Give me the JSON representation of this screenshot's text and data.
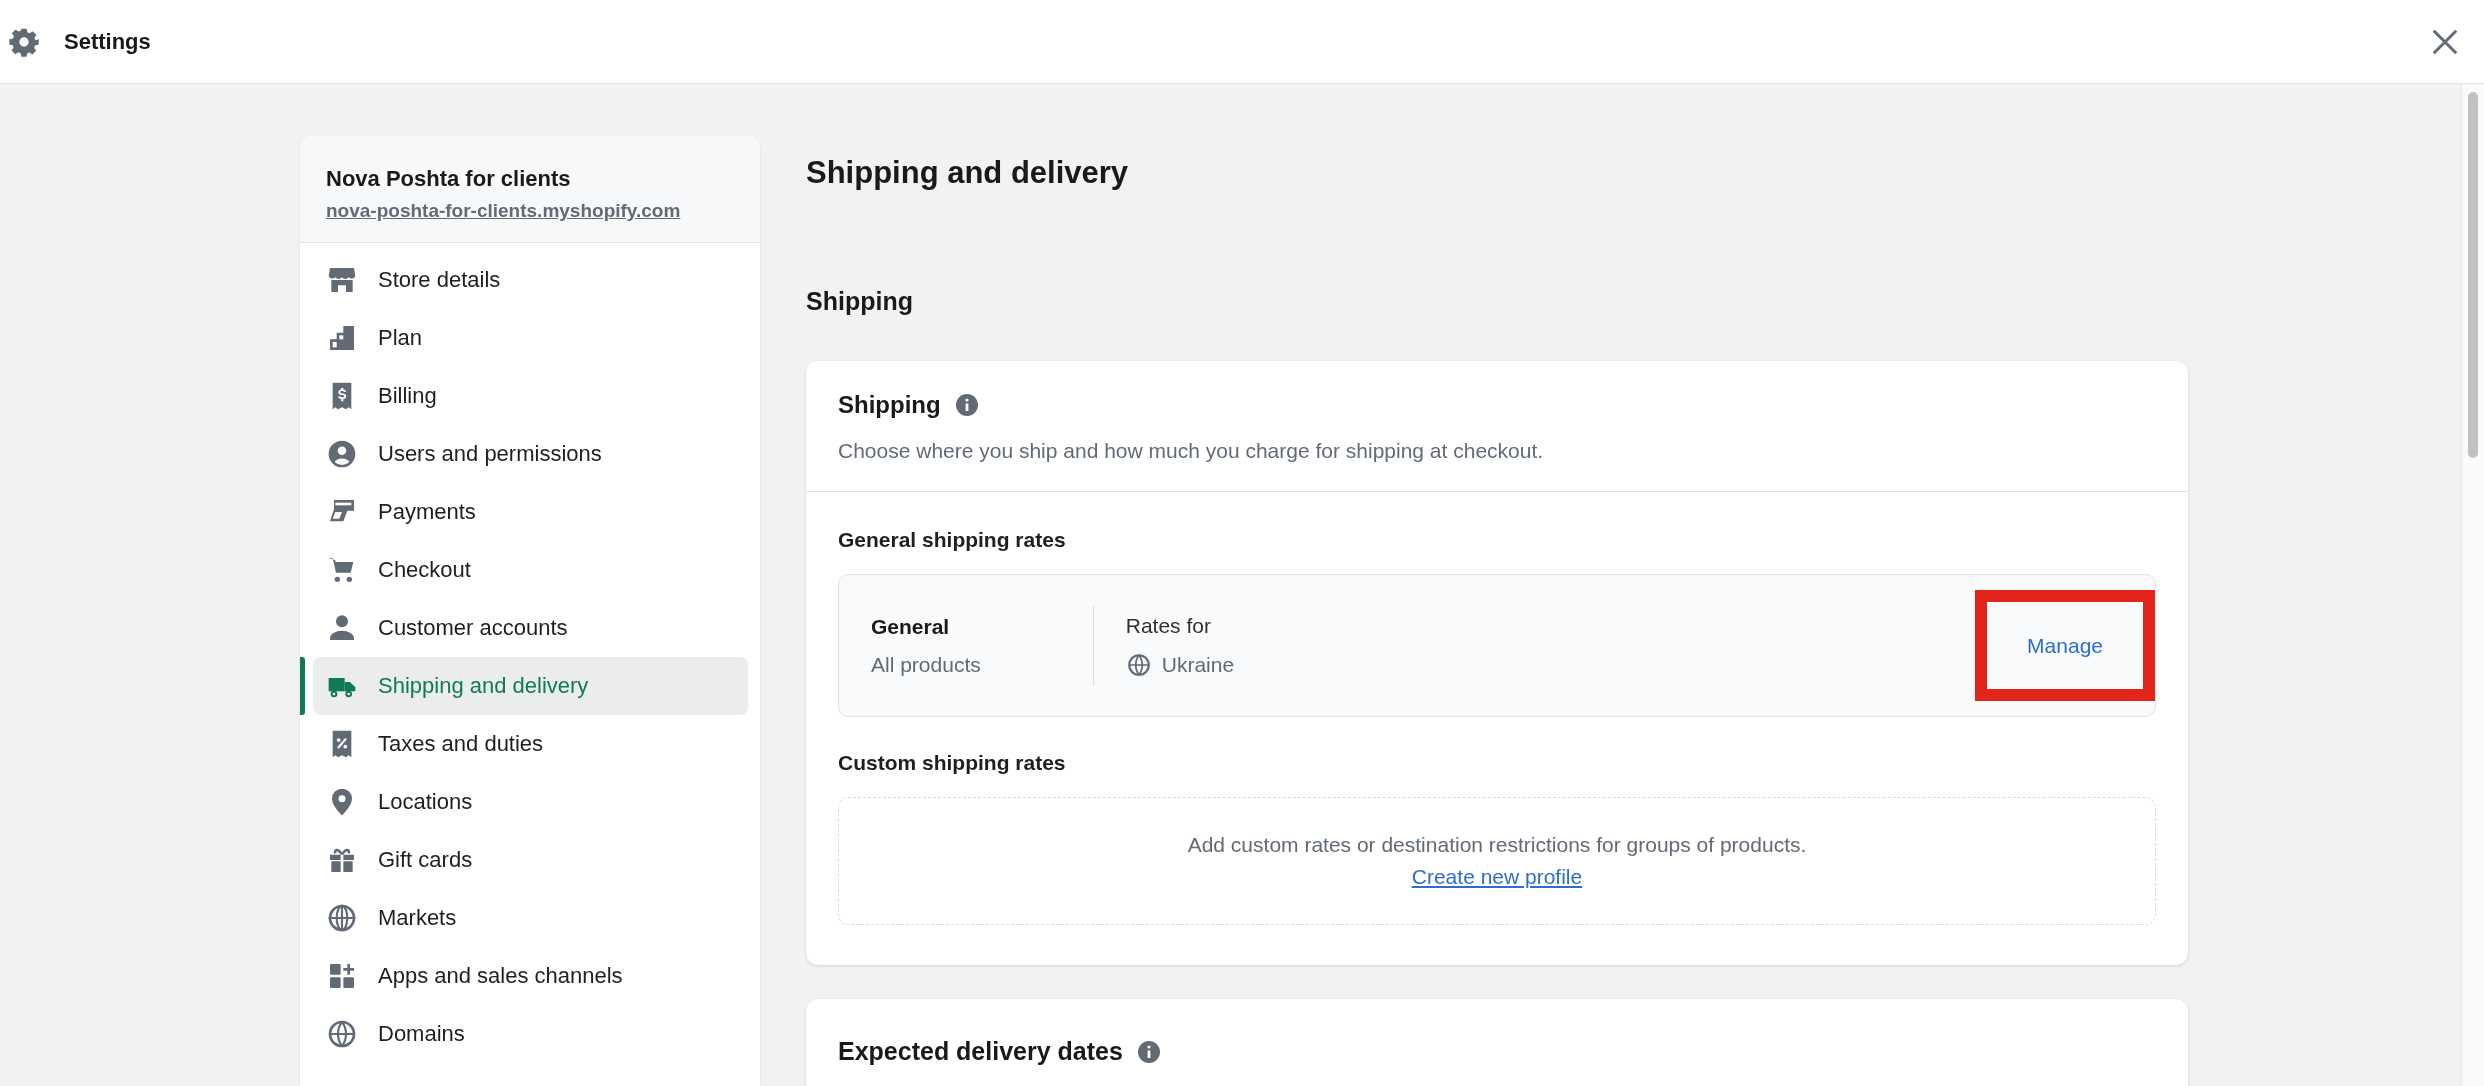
{
  "window": {
    "title": "Settings"
  },
  "store": {
    "name": "Nova Poshta for clients",
    "domain": "nova-poshta-for-clients.myshopify.com"
  },
  "nav": [
    {
      "label": "Store details",
      "selected": false
    },
    {
      "label": "Plan",
      "selected": false
    },
    {
      "label": "Billing",
      "selected": false
    },
    {
      "label": "Users and permissions",
      "selected": false
    },
    {
      "label": "Payments",
      "selected": false
    },
    {
      "label": "Checkout",
      "selected": false
    },
    {
      "label": "Customer accounts",
      "selected": false
    },
    {
      "label": "Shipping and delivery",
      "selected": true
    },
    {
      "label": "Taxes and duties",
      "selected": false
    },
    {
      "label": "Locations",
      "selected": false
    },
    {
      "label": "Gift cards",
      "selected": false
    },
    {
      "label": "Markets",
      "selected": false
    },
    {
      "label": "Apps and sales channels",
      "selected": false
    },
    {
      "label": "Domains",
      "selected": false
    }
  ],
  "page": {
    "title": "Shipping and delivery"
  },
  "shipping_section": {
    "heading": "Shipping",
    "card": {
      "title": "Shipping",
      "description": "Choose where you ship and how much you charge for shipping at checkout.",
      "general_rates": {
        "heading": "General shipping rates",
        "profile": {
          "name": "General",
          "scope": "All products",
          "rates_label": "Rates for",
          "zone": "Ukraine",
          "action": "Manage",
          "highlighted": true
        }
      },
      "custom_rates": {
        "heading": "Custom shipping rates",
        "message": "Add custom rates or destination restrictions for groups of products.",
        "link": "Create new profile"
      }
    }
  },
  "delivery_card": {
    "title": "Expected delivery dates"
  }
}
